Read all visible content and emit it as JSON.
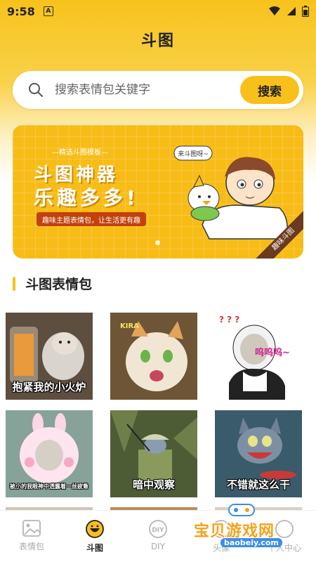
{
  "status": {
    "time": "9:58",
    "notif_letter": "A"
  },
  "header": {
    "title": "斗图"
  },
  "search": {
    "placeholder": "搜索表情包关键字",
    "button_label": "搜索"
  },
  "banner": {
    "subtitle": "—精选斗图模板—",
    "title_line1": "斗图神器",
    "title_line2": "乐趣多多!",
    "tag": "趣味主题表情包，让生活更有趣",
    "speech": "来斗图呀~",
    "ribbon": "趣味斗图"
  },
  "section": {
    "title": "斗图表情包"
  },
  "stickers": [
    {
      "caption": "抱紧我的小火炉"
    },
    {
      "caption": ""
    },
    {
      "caption": "呜呜呜~"
    },
    {
      "caption": "被小的我眼神中透露着一丝疲惫"
    },
    {
      "caption": "暗中观察"
    },
    {
      "caption": "不错就这么干"
    }
  ],
  "tabs": [
    {
      "label": "表情包",
      "icon": "image-icon"
    },
    {
      "label": "斗图",
      "icon": "smiley-icon"
    },
    {
      "label": "DIY",
      "icon": "diy-icon"
    },
    {
      "label": "头像",
      "icon": "avatar-icon"
    },
    {
      "label": "个人中心",
      "icon": "person-icon"
    }
  ],
  "watermark": {
    "text": "宝贝游戏网",
    "url": "baobeiy.com"
  },
  "colors": {
    "accent": "#f8c01b",
    "banner": "#f8bc17"
  }
}
